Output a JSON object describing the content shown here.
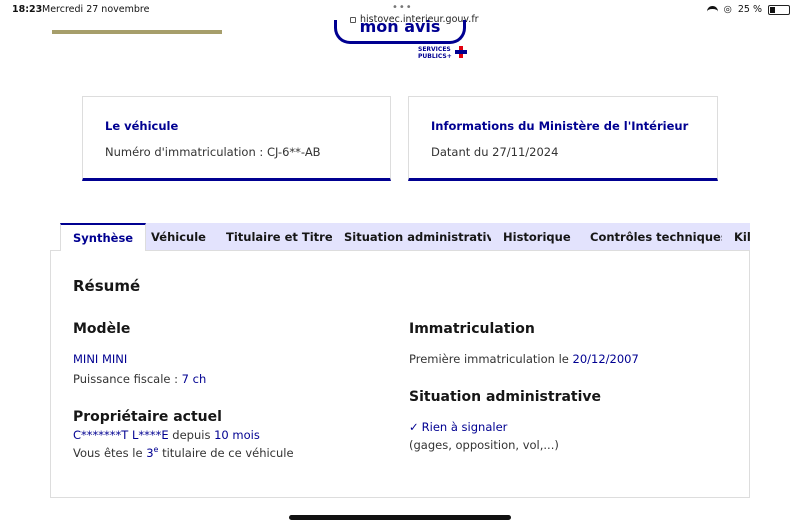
{
  "statusbar": {
    "time": "18:23",
    "date": "Mercredi 27 novembre",
    "url": "histovec.interieur.gouv.fr",
    "battery": "25 %"
  },
  "header": {
    "mon_avis": "mon avis",
    "sp_logo_line1": "SERVICES",
    "sp_logo_line2": "PUBLICS+"
  },
  "cards": {
    "vehicle": {
      "title": "Le véhicule",
      "text": "Numéro d'immatriculation : CJ-6**-AB"
    },
    "ministry": {
      "title": "Informations du Ministère de l'Intérieur",
      "text": "Datant du 27/11/2024"
    }
  },
  "tabs": [
    {
      "label": "Synthèse"
    },
    {
      "label": "Véhicule"
    },
    {
      "label": "Titulaire et Titre"
    },
    {
      "label": "Situation administrative"
    },
    {
      "label": "Historique"
    },
    {
      "label": "Contrôles techniques"
    },
    {
      "label": "Kil"
    }
  ],
  "summary": {
    "title": "Résumé",
    "model": {
      "heading": "Modèle",
      "name": "MINI MINI",
      "power_label": "Puissance fiscale :",
      "power_value": "7 ch"
    },
    "owner": {
      "heading": "Propriétaire actuel",
      "name": "C*******T L****E",
      "since_label": "depuis",
      "since_value": "10 mois",
      "rank_prefix": "Vous êtes le",
      "rank_number": "3",
      "rank_sup": "e",
      "rank_suffix": "titulaire de ce véhicule"
    },
    "registration": {
      "heading": "Immatriculation",
      "first_label": "Première immatriculation le",
      "first_date": "20/12/2007"
    },
    "admin": {
      "heading": "Situation administrative",
      "status": "Rien à signaler",
      "details": "(gages, opposition, vol,...)"
    }
  }
}
